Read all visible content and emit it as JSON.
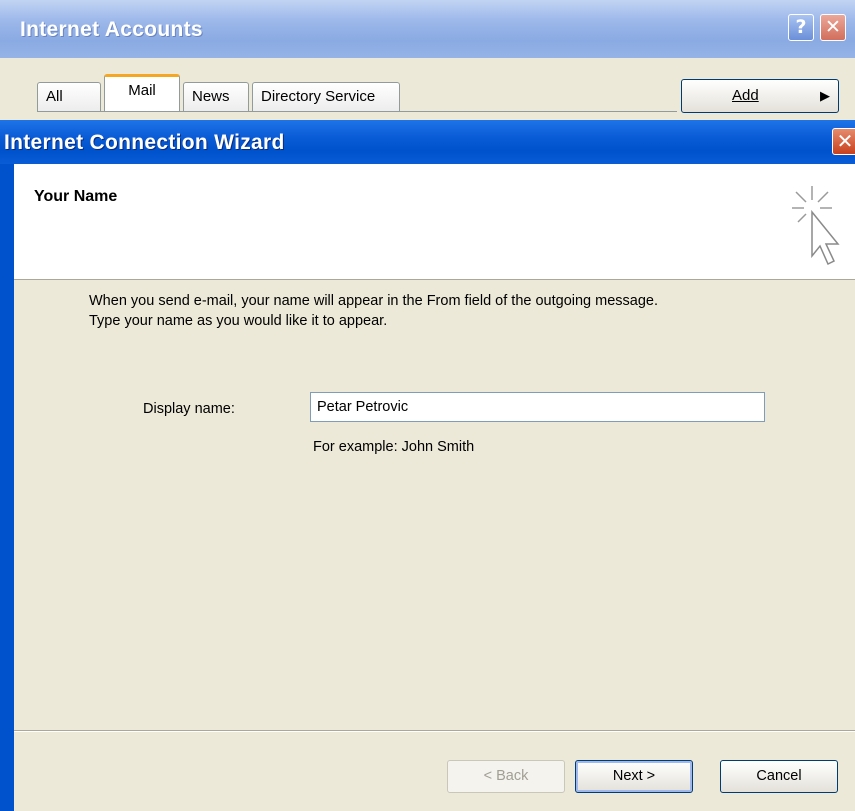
{
  "background_window": {
    "title": "Internet Accounts",
    "help_label": "?",
    "close_label": "✕",
    "tabs": [
      {
        "label": "All"
      },
      {
        "label": "Mail"
      },
      {
        "label": "News"
      },
      {
        "label": "Directory Service"
      }
    ],
    "selected_tab": "Mail",
    "add_button": {
      "label": "Add",
      "arrow": "▶"
    }
  },
  "wizard": {
    "title": "Internet Connection Wizard",
    "close_label": "✕",
    "header_title": "Your Name",
    "header_icon": "wizard-cursor-sparkle-icon",
    "description_line1": "When you send e-mail, your name will appear in the From field of the outgoing message.",
    "description_line2": "Type your name as you would like it to appear.",
    "display_name_label": "Display name:",
    "display_name_value": "Petar Petrovic",
    "example_text": "For example: John Smith",
    "buttons": {
      "back": "< Back",
      "next": "Next >",
      "cancel": "Cancel"
    }
  },
  "colors": {
    "title_bar_active": "#0052cc",
    "title_bar_inactive": "#9db8ea",
    "dialog_face": "#ECE9D8",
    "tab_highlight": "#f5a623",
    "close_button": "#c8411d"
  }
}
